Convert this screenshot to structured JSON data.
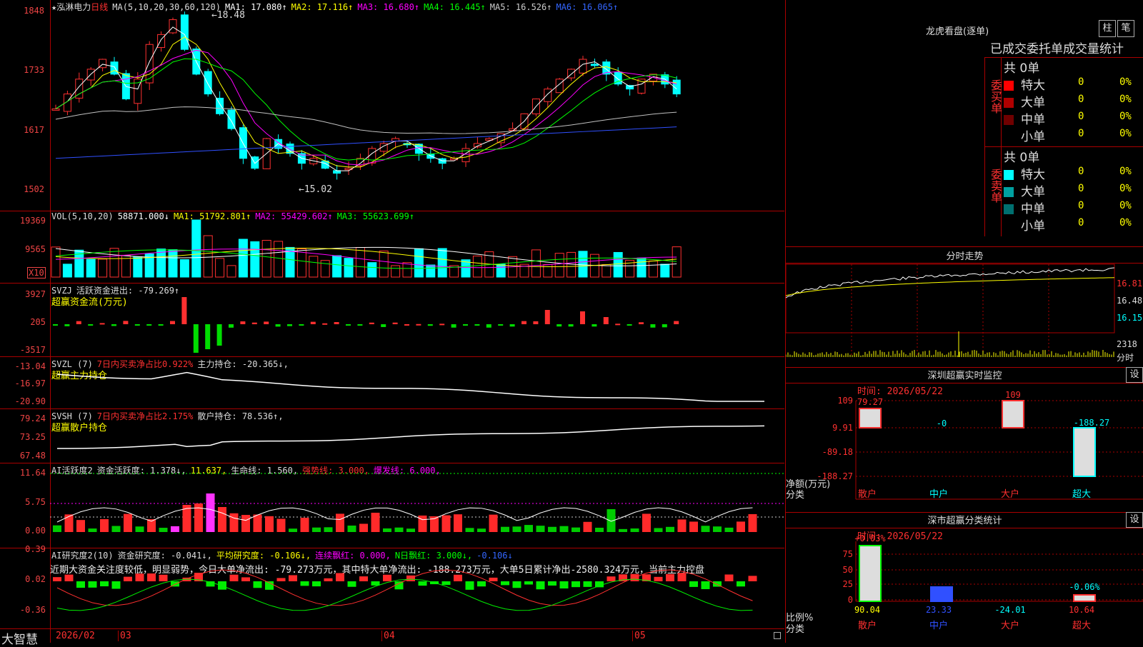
{
  "main": {
    "stock": "★泓淋电力",
    "period": "日线",
    "ma_label": "MA(5,10,20,30,60,120)",
    "ma1": "MA1: 17.080↑",
    "ma2": "MA2: 17.116↑",
    "ma3": "MA3: 16.680↑",
    "ma4": "MA4: 16.445↑",
    "ma5": "MA5: 16.526↑",
    "ma6": "MA6: 16.065↑",
    "yaxis": [
      "1848",
      "1733",
      "1617",
      "1502"
    ],
    "high_note": "18.48",
    "low_note": "15.02",
    "colors": {
      "up": "#ff3030",
      "down": "#00ffff",
      "ma1": "#ffffff",
      "ma2": "#ffff00",
      "ma3": "#ff00ff",
      "ma4": "#00ff00",
      "ma5": "#c0c0c0",
      "ma6": "#3050ff"
    }
  },
  "vol": {
    "label": "VOL(5,10,20)",
    "value": "58871.000↓",
    "ma1": "MA1: 51792.801↑",
    "ma2": "MA2: 55429.602↑",
    "ma3": "MA3: 55623.699↑",
    "yaxis": [
      "19369",
      "9565"
    ],
    "unit": "X10"
  },
  "svzj": {
    "label": "SVZJ",
    "desc": "活跃资金进出: -79.269↑",
    "sub": "超赢资金流(万元)",
    "yaxis": [
      "3927",
      "205",
      "-3517"
    ]
  },
  "svzl": {
    "label": "SVZL (7)",
    "desc1": "7日内买卖净占比0.922%",
    "desc2": "主力持仓: -20.365↓,",
    "sub": "超赢主力持仓",
    "yaxis": [
      "-13.04",
      "-16.97",
      "-20.90"
    ]
  },
  "svsh": {
    "label": "SVSH (7)",
    "desc1": "7日内买卖净占比2.175%",
    "desc2": "散户持仓: 78.536↑,",
    "sub": "超赢散户持仓",
    "yaxis": [
      "79.24",
      "73.25",
      "67.48"
    ]
  },
  "ai1": {
    "label": "AI活跃度2",
    "desc1": "资金活跃度: 1.378↓,",
    "desc2": "11.637,",
    "desc3": "生命线: 1.560,",
    "desc4": "强势线: 3.000,",
    "desc5": "爆发线: 6.000,",
    "yaxis": [
      "11.64",
      "5.75",
      "0.00"
    ]
  },
  "ai2": {
    "label": "AI研究度2(10)",
    "desc1": "资金研究度: -0.041↓,",
    "desc2": "平均研究度: -0.106↓,",
    "desc3": "连续飘红: 0.000,",
    "desc4": "N日飘红: 3.000↓,",
    "desc5": "-0.106↓",
    "note": "近期大资金关注度较低，明显弱势，今日大单净流出: -79.273万元，其中特大单净流出: -188.273万元，大单5日累计净出-2580.324万元，当前主力控盘",
    "yaxis": [
      "0.39",
      "0.02",
      "-0.36"
    ]
  },
  "timeline": {
    "brand": "大智慧",
    "labels": [
      "2026/02",
      "03",
      "04",
      "05"
    ]
  },
  "right": {
    "lhb_title": "龙虎看盘(逐单)",
    "btn_bar": "柱",
    "btn_pen": "笔",
    "stats_title": "已成交委托单成交量统计",
    "buy_side": "委买单",
    "sell_side": "委卖单",
    "buy_total": "共 0单",
    "sell_total": "共 0单",
    "buy_rows": [
      {
        "name": "特大",
        "count": "0",
        "pct": "0%",
        "color": "#ff0000"
      },
      {
        "name": "大单",
        "count": "0",
        "pct": "0%",
        "color": "#b00000"
      },
      {
        "name": "中单",
        "count": "0",
        "pct": "0%",
        "color": "#700000"
      },
      {
        "name": "小单",
        "count": "0",
        "pct": "0%",
        "color": ""
      }
    ],
    "sell_rows": [
      {
        "name": "特大",
        "count": "0",
        "pct": "0%",
        "color": "#00ffff"
      },
      {
        "name": "大单",
        "count": "0",
        "pct": "0%",
        "color": "#00a0a0"
      },
      {
        "name": "中单",
        "count": "0",
        "pct": "0%",
        "color": "#007070"
      },
      {
        "name": "小单",
        "count": "0",
        "pct": "0%",
        "color": ""
      }
    ],
    "intraday_title": "分时走势",
    "intraday_y": [
      "16.81",
      "16.48",
      "16.15"
    ],
    "intraday_vol": "2318",
    "intraday_vol_unit": "分时",
    "sz_title": "深圳超赢实时监控",
    "sz_btn": "设",
    "sz_time": "时间: 2026/05/22",
    "sz_y": [
      "109",
      "9.91",
      "-89.18",
      "-188.27"
    ],
    "sz_ylabel": "净额(万元)",
    "sz_xlabel": "分类",
    "sz_cats": [
      "散户",
      "中户",
      "大户",
      "超大"
    ],
    "sz_vals": [
      "79.27",
      "-0",
      "109",
      "-188.27"
    ],
    "cls_title": "深市超赢分类统计",
    "cls_btn": "设",
    "cls_time": "时间: 2026/05/22",
    "cls_y": [
      "75",
      "50",
      "25",
      "0"
    ],
    "cls_ylabel": "比例%",
    "cls_xlabel": "分类",
    "cls_top": [
      "+0.03%",
      "-0.06%"
    ],
    "cls_vals": [
      "90.04",
      "23.33",
      "-24.01",
      "10.64"
    ],
    "cls_cats": [
      "散户",
      "中户",
      "大户",
      "超大"
    ]
  }
}
